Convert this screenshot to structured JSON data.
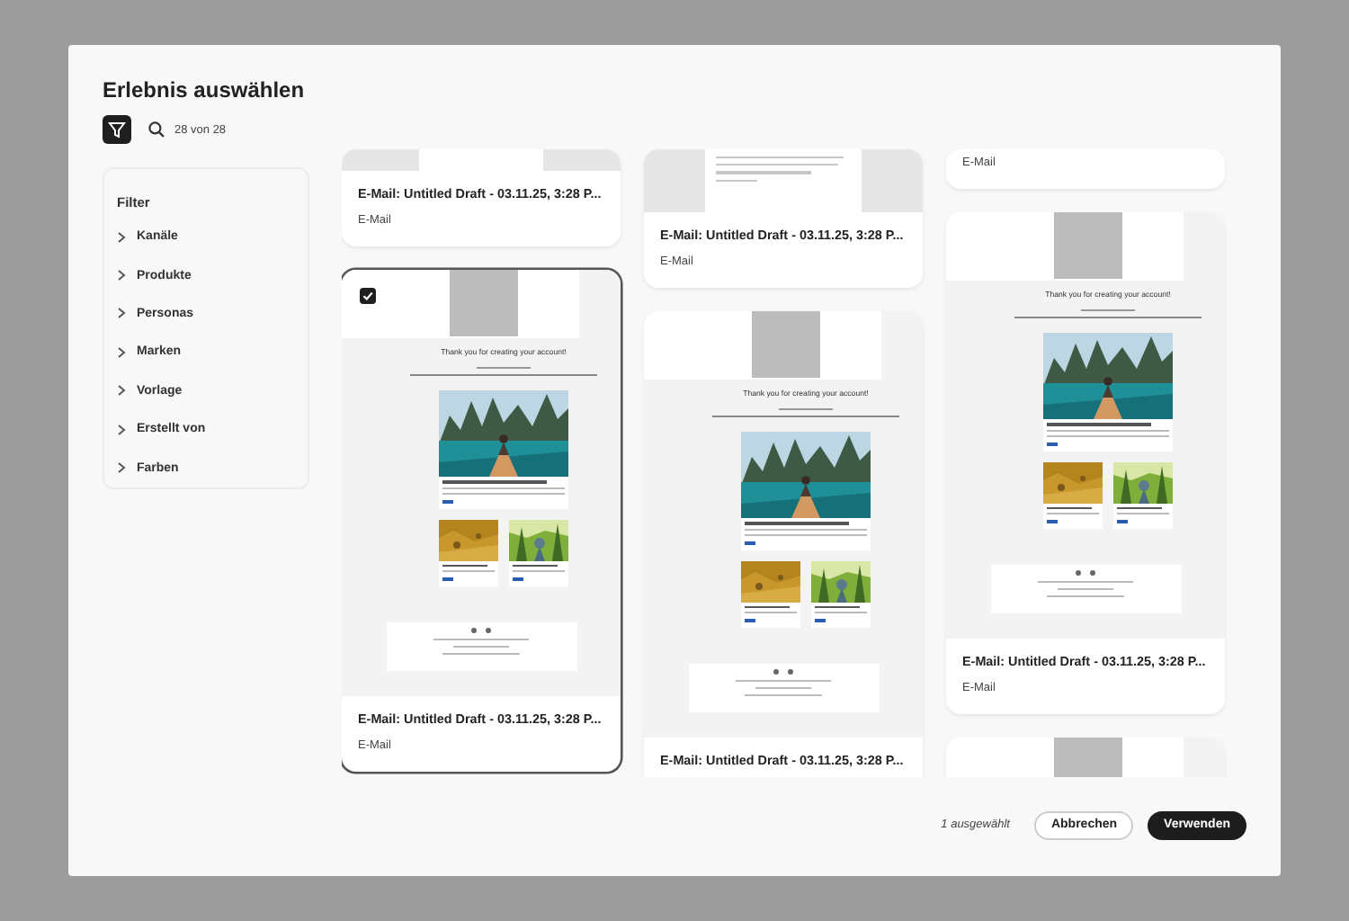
{
  "dialog": {
    "title": "Erlebnis auswählen"
  },
  "toolbar": {
    "filter_active": true,
    "count": "28 von 28"
  },
  "filters": {
    "title": "Filter",
    "items": [
      {
        "label": "Kanäle",
        "expanded": false
      },
      {
        "label": "Produkte",
        "expanded": false
      },
      {
        "label": "Personas",
        "expanded": false
      },
      {
        "label": "Marken",
        "expanded": false
      },
      {
        "label": "Vorlage",
        "expanded": false
      },
      {
        "label": "Erstellt von",
        "expanded": false
      },
      {
        "label": "Farben",
        "expanded": false
      }
    ]
  },
  "columns": [
    {
      "cards": [
        {
          "kind": "banner",
          "title": "E-Mail: Untitled Draft - 03.11.25, 3:28 P...",
          "type": "E-Mail",
          "selected": false
        },
        {
          "kind": "travel",
          "greeting": "Thank you for creating your account!",
          "title": "E-Mail: Untitled Draft - 03.11.25, 3:28 P...",
          "type": "E-Mail",
          "selected": true
        }
      ]
    },
    {
      "cards": [
        {
          "kind": "text",
          "title": "E-Mail: Untitled Draft - 03.11.25, 3:28 P...",
          "type": "E-Mail",
          "selected": false
        },
        {
          "kind": "travel",
          "greeting": "Thank you for creating your account!",
          "title": "E-Mail: Untitled Draft - 03.11.25, 3:28 P...",
          "selected": false
        }
      ]
    },
    {
      "cards": [
        {
          "kind": "footer",
          "type": "E-Mail",
          "selected": false
        },
        {
          "kind": "travel",
          "greeting": "Thank you for creating your account!",
          "title": "E-Mail: Untitled Draft - 03.11.25, 3:28 P...",
          "type": "E-Mail",
          "selected": false
        },
        {
          "kind": "logo",
          "selected": false
        }
      ]
    }
  ],
  "footer": {
    "selection": "1 ausgewählt",
    "buttons": [
      {
        "label": "Abbrechen",
        "kind": "secondary"
      },
      {
        "label": "Verwenden",
        "kind": "primary"
      }
    ]
  }
}
